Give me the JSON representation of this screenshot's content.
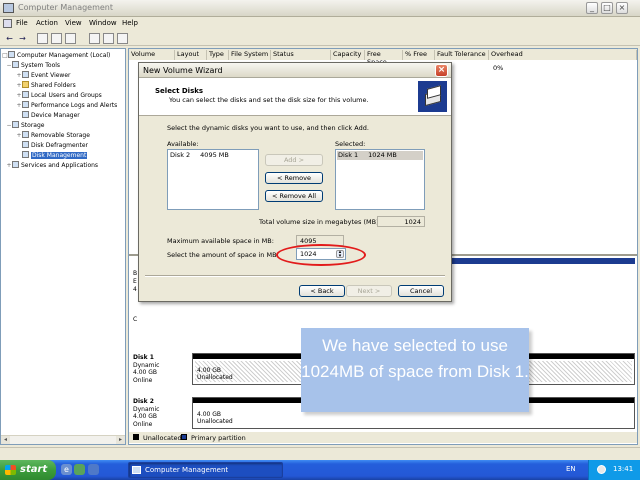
{
  "window": {
    "title": "Computer Management",
    "controls": [
      "_",
      "□",
      "×"
    ]
  },
  "menu": [
    "File",
    "Action",
    "View",
    "Window",
    "Help"
  ],
  "tree": [
    {
      "label": "Computer Management (Local)",
      "level": 0
    },
    {
      "label": "System Tools",
      "level": 1
    },
    {
      "label": "Event Viewer",
      "level": 2
    },
    {
      "label": "Shared Folders",
      "level": 2
    },
    {
      "label": "Local Users and Groups",
      "level": 2
    },
    {
      "label": "Performance Logs and Alerts",
      "level": 2
    },
    {
      "label": "Device Manager",
      "level": 2
    },
    {
      "label": "Storage",
      "level": 1
    },
    {
      "label": "Removable Storage",
      "level": 2
    },
    {
      "label": "Disk Defragmenter",
      "level": 2
    },
    {
      "label": "Disk Management",
      "level": 2,
      "selected": true
    },
    {
      "label": "Services and Applications",
      "level": 1
    }
  ],
  "columns": [
    "Volume",
    "Layout",
    "Type",
    "File System",
    "Status",
    "Capacity",
    "Free Space",
    "% Free",
    "Fault Tolerance",
    "Overhead"
  ],
  "volume_row": {
    "overhead": "0%"
  },
  "disks": [
    {
      "name": "Disk 1",
      "type": "Dynamic",
      "size": "4.00 GB",
      "status": "Online",
      "part_size": "4.00 GB",
      "part_status": "Unallocated"
    },
    {
      "name": "Disk 2",
      "type": "Dynamic",
      "size": "4.00 GB",
      "status": "Online",
      "part_size": "4.00 GB",
      "part_status": "Unallocated"
    }
  ],
  "partial_labels": [
    "B",
    "E",
    "4",
    "C"
  ],
  "legend": [
    {
      "label": "Unallocated",
      "color": "#000000"
    },
    {
      "label": "Primary partition",
      "color": "#1c3b90"
    }
  ],
  "dialog": {
    "title": "New Volume Wizard",
    "heading": "Select Disks",
    "subheading": "You can select the disks and set the disk size for this volume.",
    "instruction": "Select the dynamic disks you want to use, and then click Add.",
    "available_label": "Available:",
    "available_items": [
      {
        "disk": "Disk 2",
        "size": "4095 MB"
      }
    ],
    "selected_label": "Selected:",
    "selected_items": [
      {
        "disk": "Disk 1",
        "size": "1024 MB"
      }
    ],
    "add_button": "Add >",
    "remove_button": "< Remove",
    "remove_all_button": "< Remove All",
    "total_label": "Total volume size in megabytes (MB):",
    "total_value": "1024",
    "max_label": "Maximum available space in MB:",
    "max_value": "4095",
    "amount_label": "Select the amount of space in MB:",
    "amount_value": "1024",
    "back_button": "< Back",
    "next_button": "Next >",
    "cancel_button": "Cancel"
  },
  "callout": {
    "text": "We have selected to use 1024MB of space from Disk 1."
  },
  "taskbar": {
    "start_label": "start",
    "task_label": "Computer Management",
    "language": "EN",
    "clock": "13:41"
  },
  "colors": {
    "accent": "#316ac5",
    "highlight_ring": "#e21b1b",
    "callout_bg": "#a7c2ea"
  }
}
